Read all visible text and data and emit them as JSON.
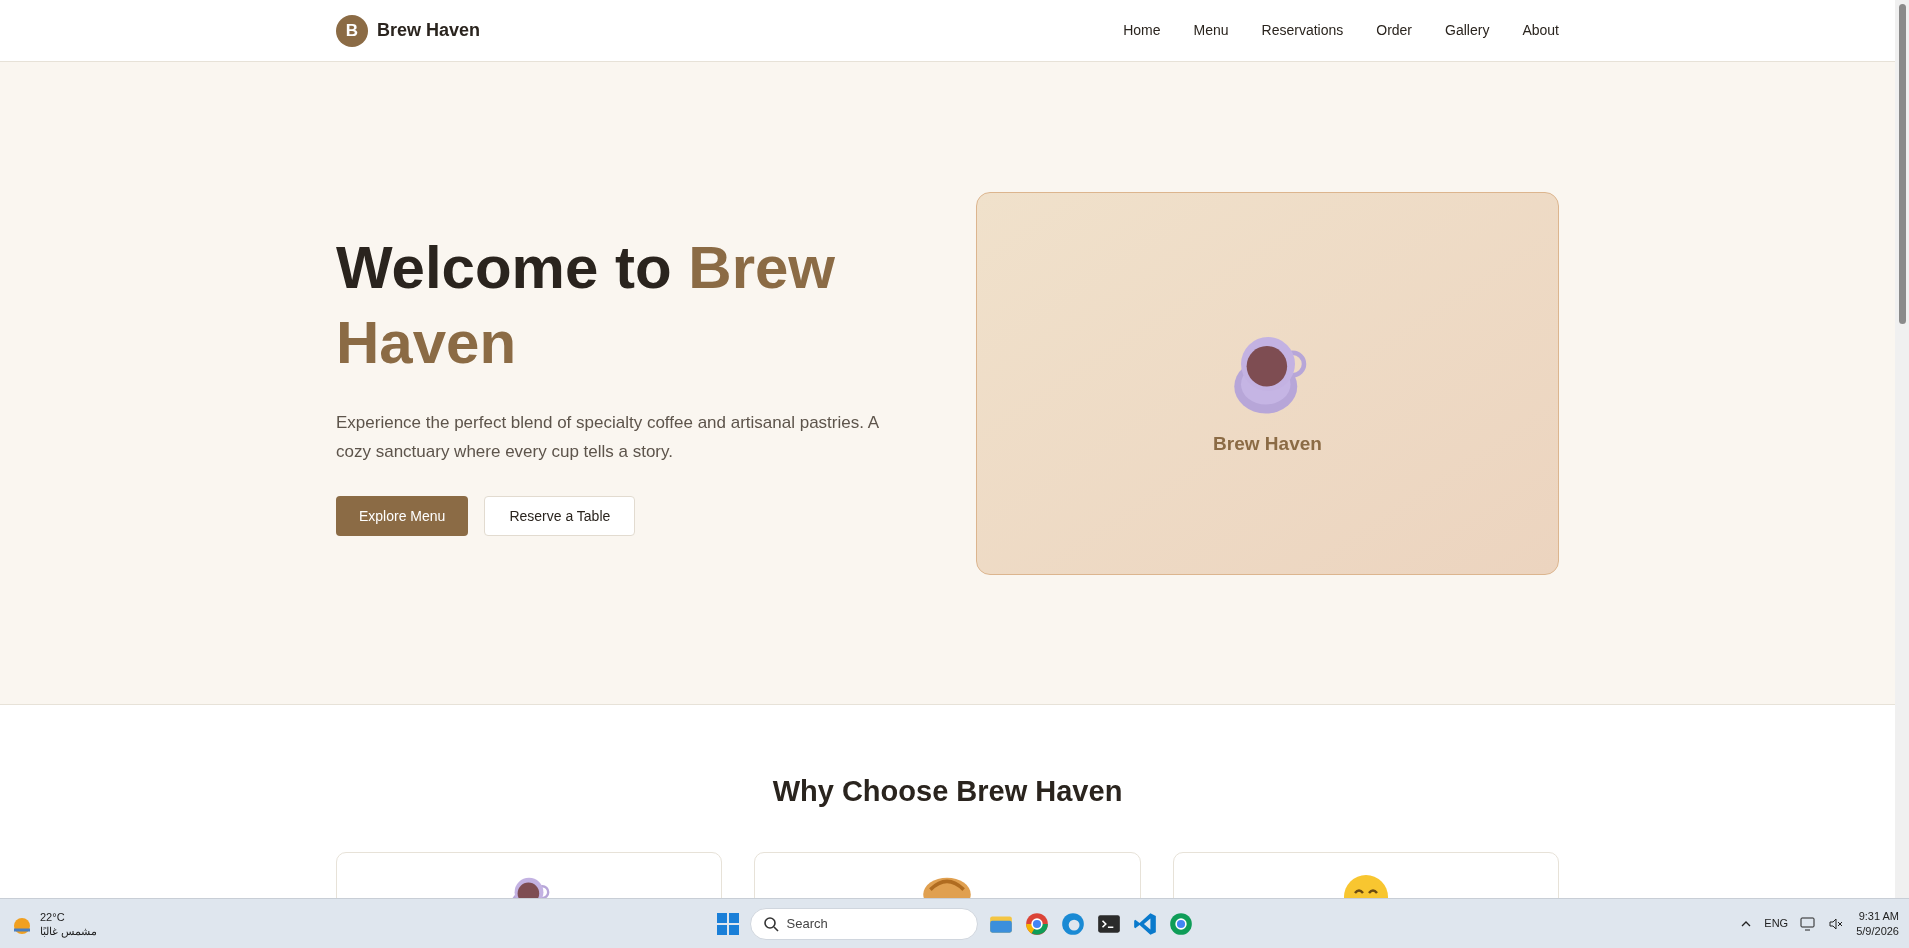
{
  "header": {
    "logo_letter": "B",
    "brand": "Brew Haven",
    "nav": [
      {
        "label": "Home"
      },
      {
        "label": "Menu"
      },
      {
        "label": "Reservations"
      },
      {
        "label": "Order"
      },
      {
        "label": "Gallery"
      },
      {
        "label": "About"
      }
    ]
  },
  "hero": {
    "title_plain": "Welcome to",
    "title_accent": "Brew Haven",
    "description": "Experience the perfect blend of specialty coffee and artisanal pastries. A cozy sanctuary where every cup tells a story.",
    "buttons": [
      {
        "label": "Explore Menu",
        "kind": "primary"
      },
      {
        "label": "Reserve a Table",
        "kind": "secondary"
      }
    ],
    "card_caption": "Brew Haven"
  },
  "features": {
    "title": "Why Choose Brew Haven",
    "cards": [
      {
        "kind": "cup"
      },
      {
        "kind": "croissant"
      },
      {
        "kind": "smile"
      }
    ]
  },
  "taskbar": {
    "temperature": "22°C",
    "weather": "مشمس غالبًا",
    "search_placeholder": "Search",
    "language": "ENG",
    "time": "9:31 AM",
    "date": "5/9/2026"
  }
}
